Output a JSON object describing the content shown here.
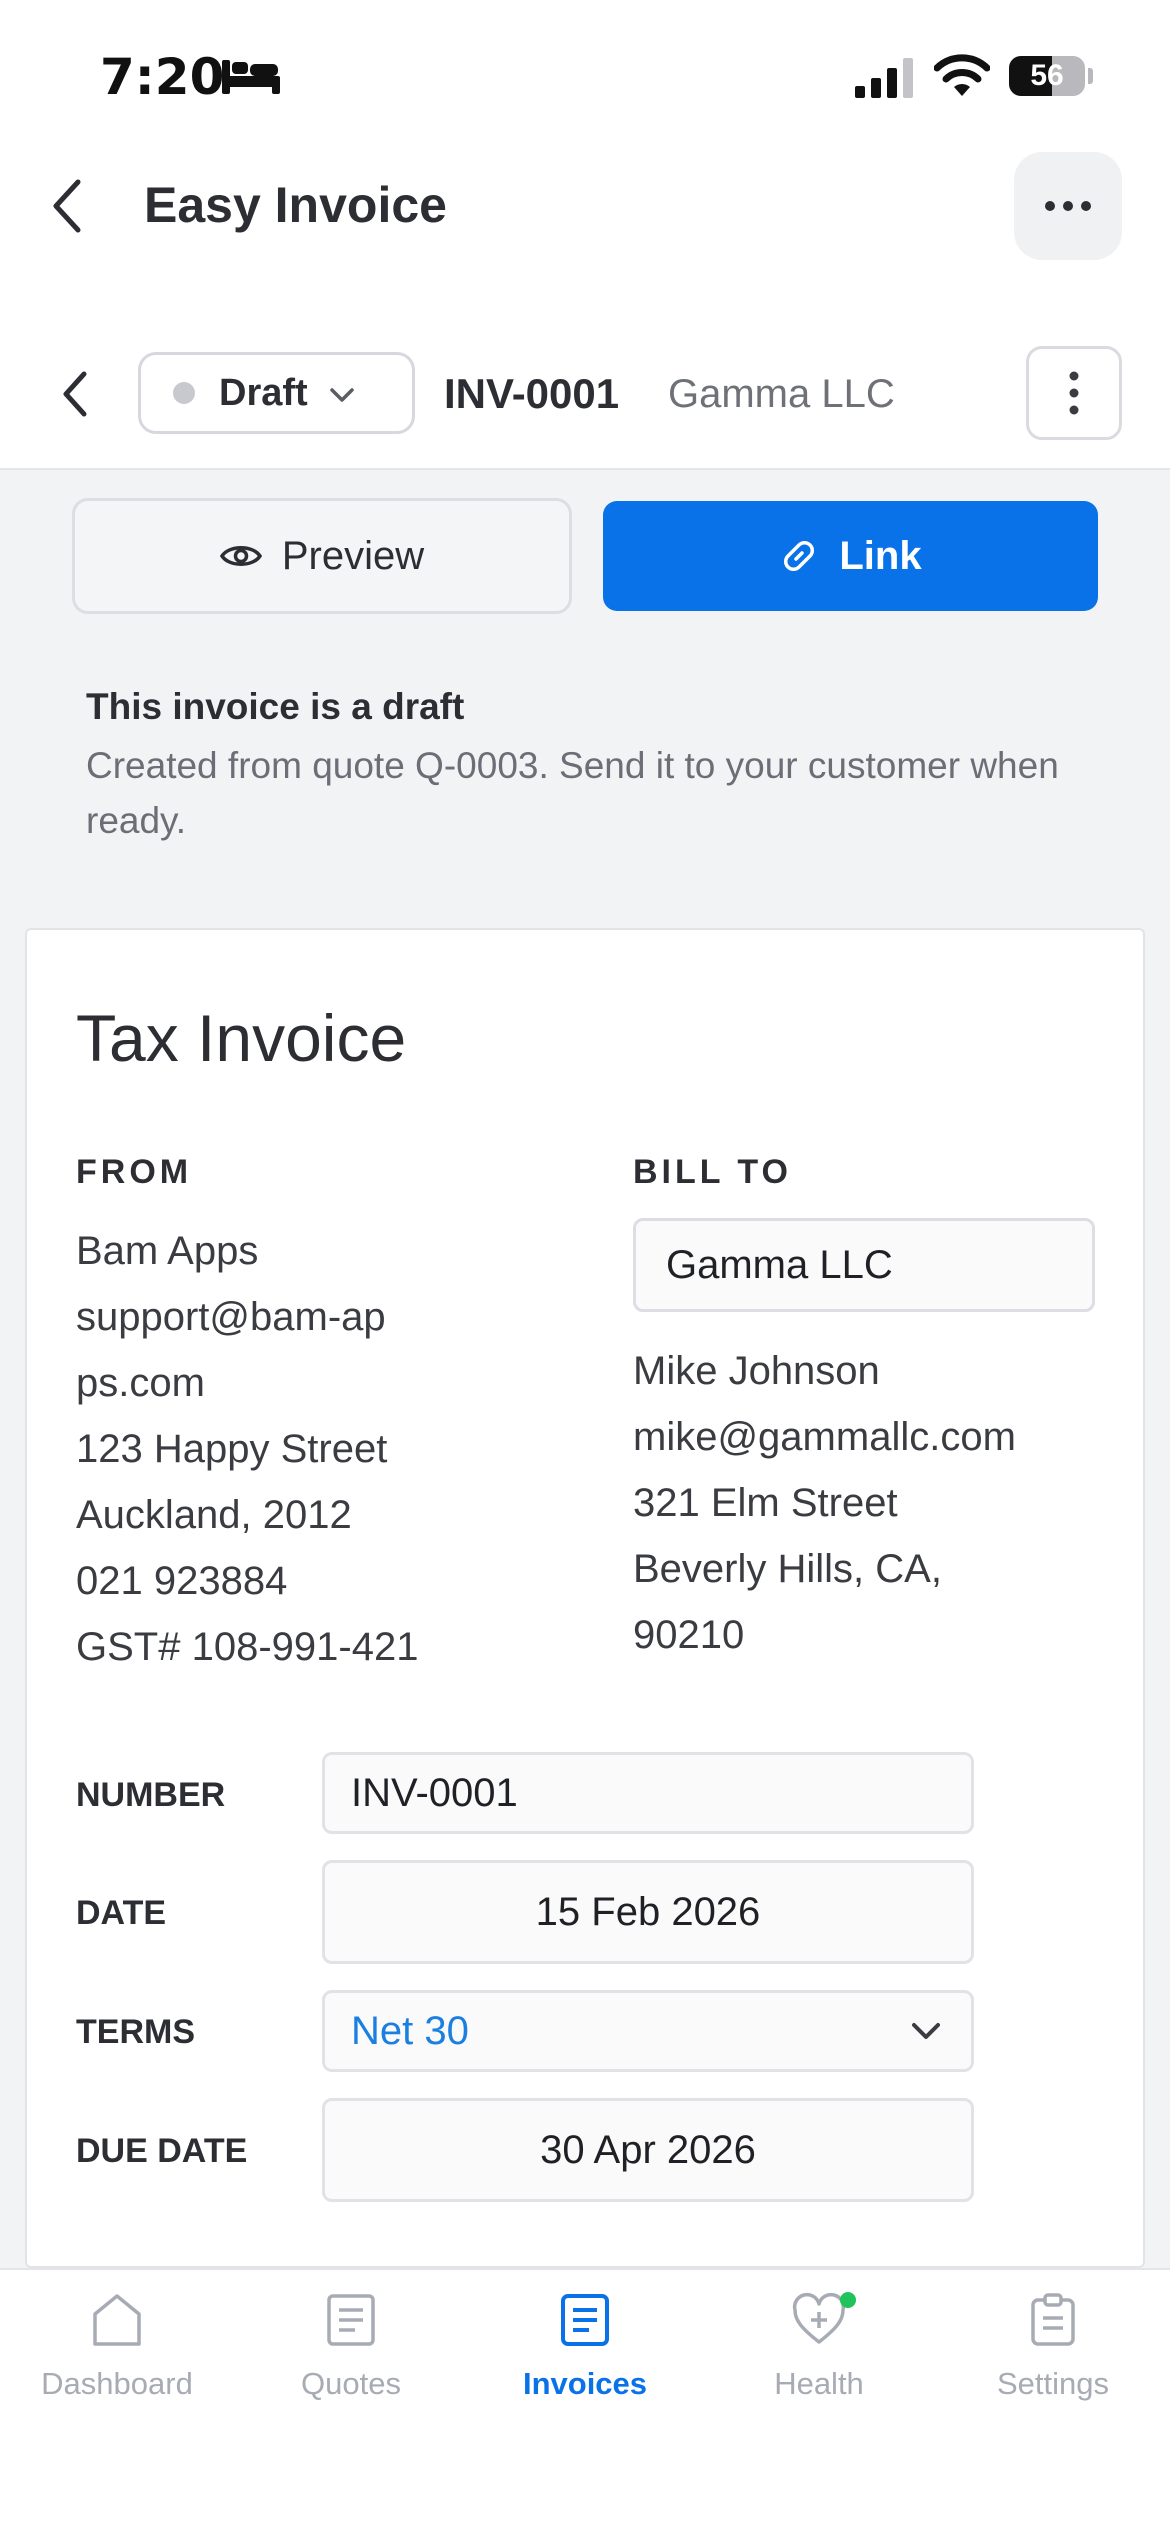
{
  "status_bar": {
    "time": "7:20",
    "battery": "56"
  },
  "header": {
    "title": "Easy Invoice"
  },
  "invoice_bar": {
    "status": "Draft",
    "number": "INV-0001",
    "client": "Gamma LLC"
  },
  "actions": {
    "preview": "Preview",
    "link": "Link"
  },
  "notice": {
    "title": "This invoice is a draft",
    "message": "Created from quote Q-0003. Send it to your customer when ready."
  },
  "invoice": {
    "heading": "Tax Invoice",
    "from_label": "FROM",
    "from": {
      "name": "Bam Apps",
      "email": "support@bam-apps.com",
      "address": "123 Happy Street",
      "city": "Auckland, 2012",
      "phone": "021 923884",
      "gst": "GST# 108-991-421"
    },
    "bill_to_label": "BILL TO",
    "bill_to": {
      "company": "Gamma LLC",
      "contact": "Mike Johnson",
      "email": "mike@gammallc.com",
      "address": "321 Elm Street",
      "city": "Beverly Hills, CA, 90210"
    },
    "fields": {
      "number_label": "NUMBER",
      "number": "INV-0001",
      "date_label": "DATE",
      "date": "15 Feb 2026",
      "terms_label": "TERMS",
      "terms": "Net 30",
      "due_label": "DUE DATE",
      "due": "30 Apr 2026"
    }
  },
  "tabs": [
    {
      "label": "Dashboard",
      "icon": "home-icon"
    },
    {
      "label": "Quotes",
      "icon": "document-icon"
    },
    {
      "label": "Invoices",
      "icon": "invoice-icon",
      "active": true
    },
    {
      "label": "Health",
      "icon": "heart-plus-icon"
    },
    {
      "label": "Settings",
      "icon": "clipboard-icon"
    }
  ],
  "colors": {
    "accent": "#0a72e8",
    "terms_text": "#1a7fe0",
    "health_badge": "#22c25e"
  }
}
